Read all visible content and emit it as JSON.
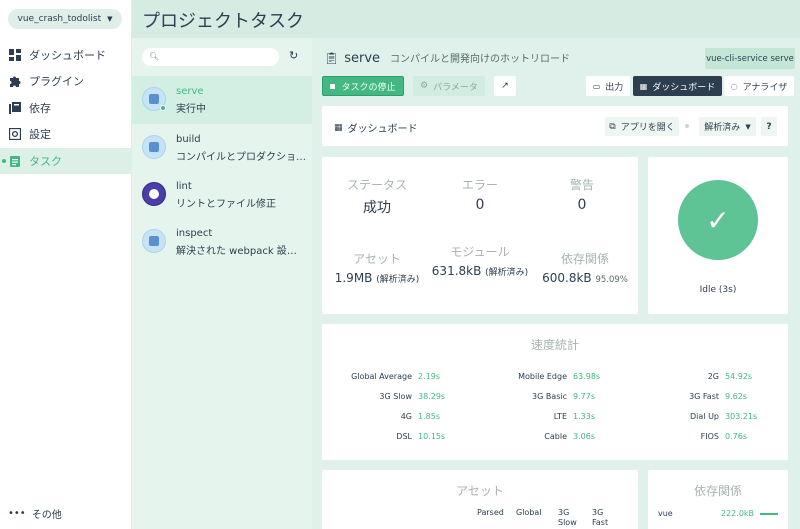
{
  "nav": {
    "project": "vue_crash_todolist",
    "items": [
      {
        "label": "ダッシュボード",
        "icon": "dashboard-icon"
      },
      {
        "label": "プラグイン",
        "icon": "puzzle-icon"
      },
      {
        "label": "依存",
        "icon": "library-icon"
      },
      {
        "label": "設定",
        "icon": "settings-icon"
      },
      {
        "label": "タスク",
        "icon": "tasks-icon",
        "active": true
      }
    ],
    "more": "その他"
  },
  "header": {
    "title": "プロジェクトタスク"
  },
  "tasklist": {
    "tasks": [
      {
        "name": "serve",
        "desc": "実行中"
      },
      {
        "name": "build",
        "desc": "コンパイルとプロダクショ…"
      },
      {
        "name": "lint",
        "desc": "リントとファイル修正"
      },
      {
        "name": "inspect",
        "desc": "解決された webpack 設定…"
      }
    ]
  },
  "task": {
    "title": "serve",
    "subtitle": "コンパイルと開発向けのホットリロード",
    "command": "vue-cli-service serve",
    "stop_label": "タスクの停止",
    "params_label": "パラメータ",
    "tabs": {
      "output": "出力",
      "dashboard": "ダッシュボード",
      "analyzer": "アナライザ"
    }
  },
  "dashboard": {
    "label": "ダッシュボード",
    "open_app": "アプリを開く",
    "parsed_select": "解析済み",
    "help": "?",
    "status": {
      "k": "ステータス",
      "v": "成功"
    },
    "errors": {
      "k": "エラー",
      "v": "0"
    },
    "warnings": {
      "k": "警告",
      "v": "0"
    },
    "assets": {
      "k": "アセット",
      "v": "1.9MB",
      "note": "(解析済み)"
    },
    "modules": {
      "k": "モジュール",
      "v": "631.8kB",
      "note": "(解析済み)"
    },
    "deps": {
      "k": "依存関係",
      "v": "600.8kB",
      "pct": "95.09%"
    },
    "idle": "Idle (3s)"
  },
  "speed": {
    "title": "速度統計",
    "rows": [
      [
        {
          "k": "Global Average",
          "v": "2.19s"
        },
        {
          "k": "Mobile Edge",
          "v": "63.98s"
        },
        {
          "k": "2G",
          "v": "54.92s"
        }
      ],
      [
        {
          "k": "3G Slow",
          "v": "38.29s"
        },
        {
          "k": "3G Basic",
          "v": "9.77s"
        },
        {
          "k": "3G Fast",
          "v": "9.62s"
        }
      ],
      [
        {
          "k": "4G",
          "v": "1.85s"
        },
        {
          "k": "LTE",
          "v": "1.33s"
        },
        {
          "k": "Dial Up",
          "v": "303.21s"
        }
      ],
      [
        {
          "k": "DSL",
          "v": "10.15s"
        },
        {
          "k": "Cable",
          "v": "3.06s"
        },
        {
          "k": "FIOS",
          "v": "0.76s"
        }
      ]
    ]
  },
  "assets_card": {
    "title": "アセット",
    "cols": [
      "Parsed",
      "Global",
      "3G Slow",
      "3G Fast"
    ]
  },
  "deps_card": {
    "title": "依存関係",
    "row": {
      "name": "vue",
      "size": "222.0kB"
    }
  },
  "colors": {
    "accent": "#42b983",
    "dark": "#2c3e50",
    "bg": "#dff1ea"
  }
}
